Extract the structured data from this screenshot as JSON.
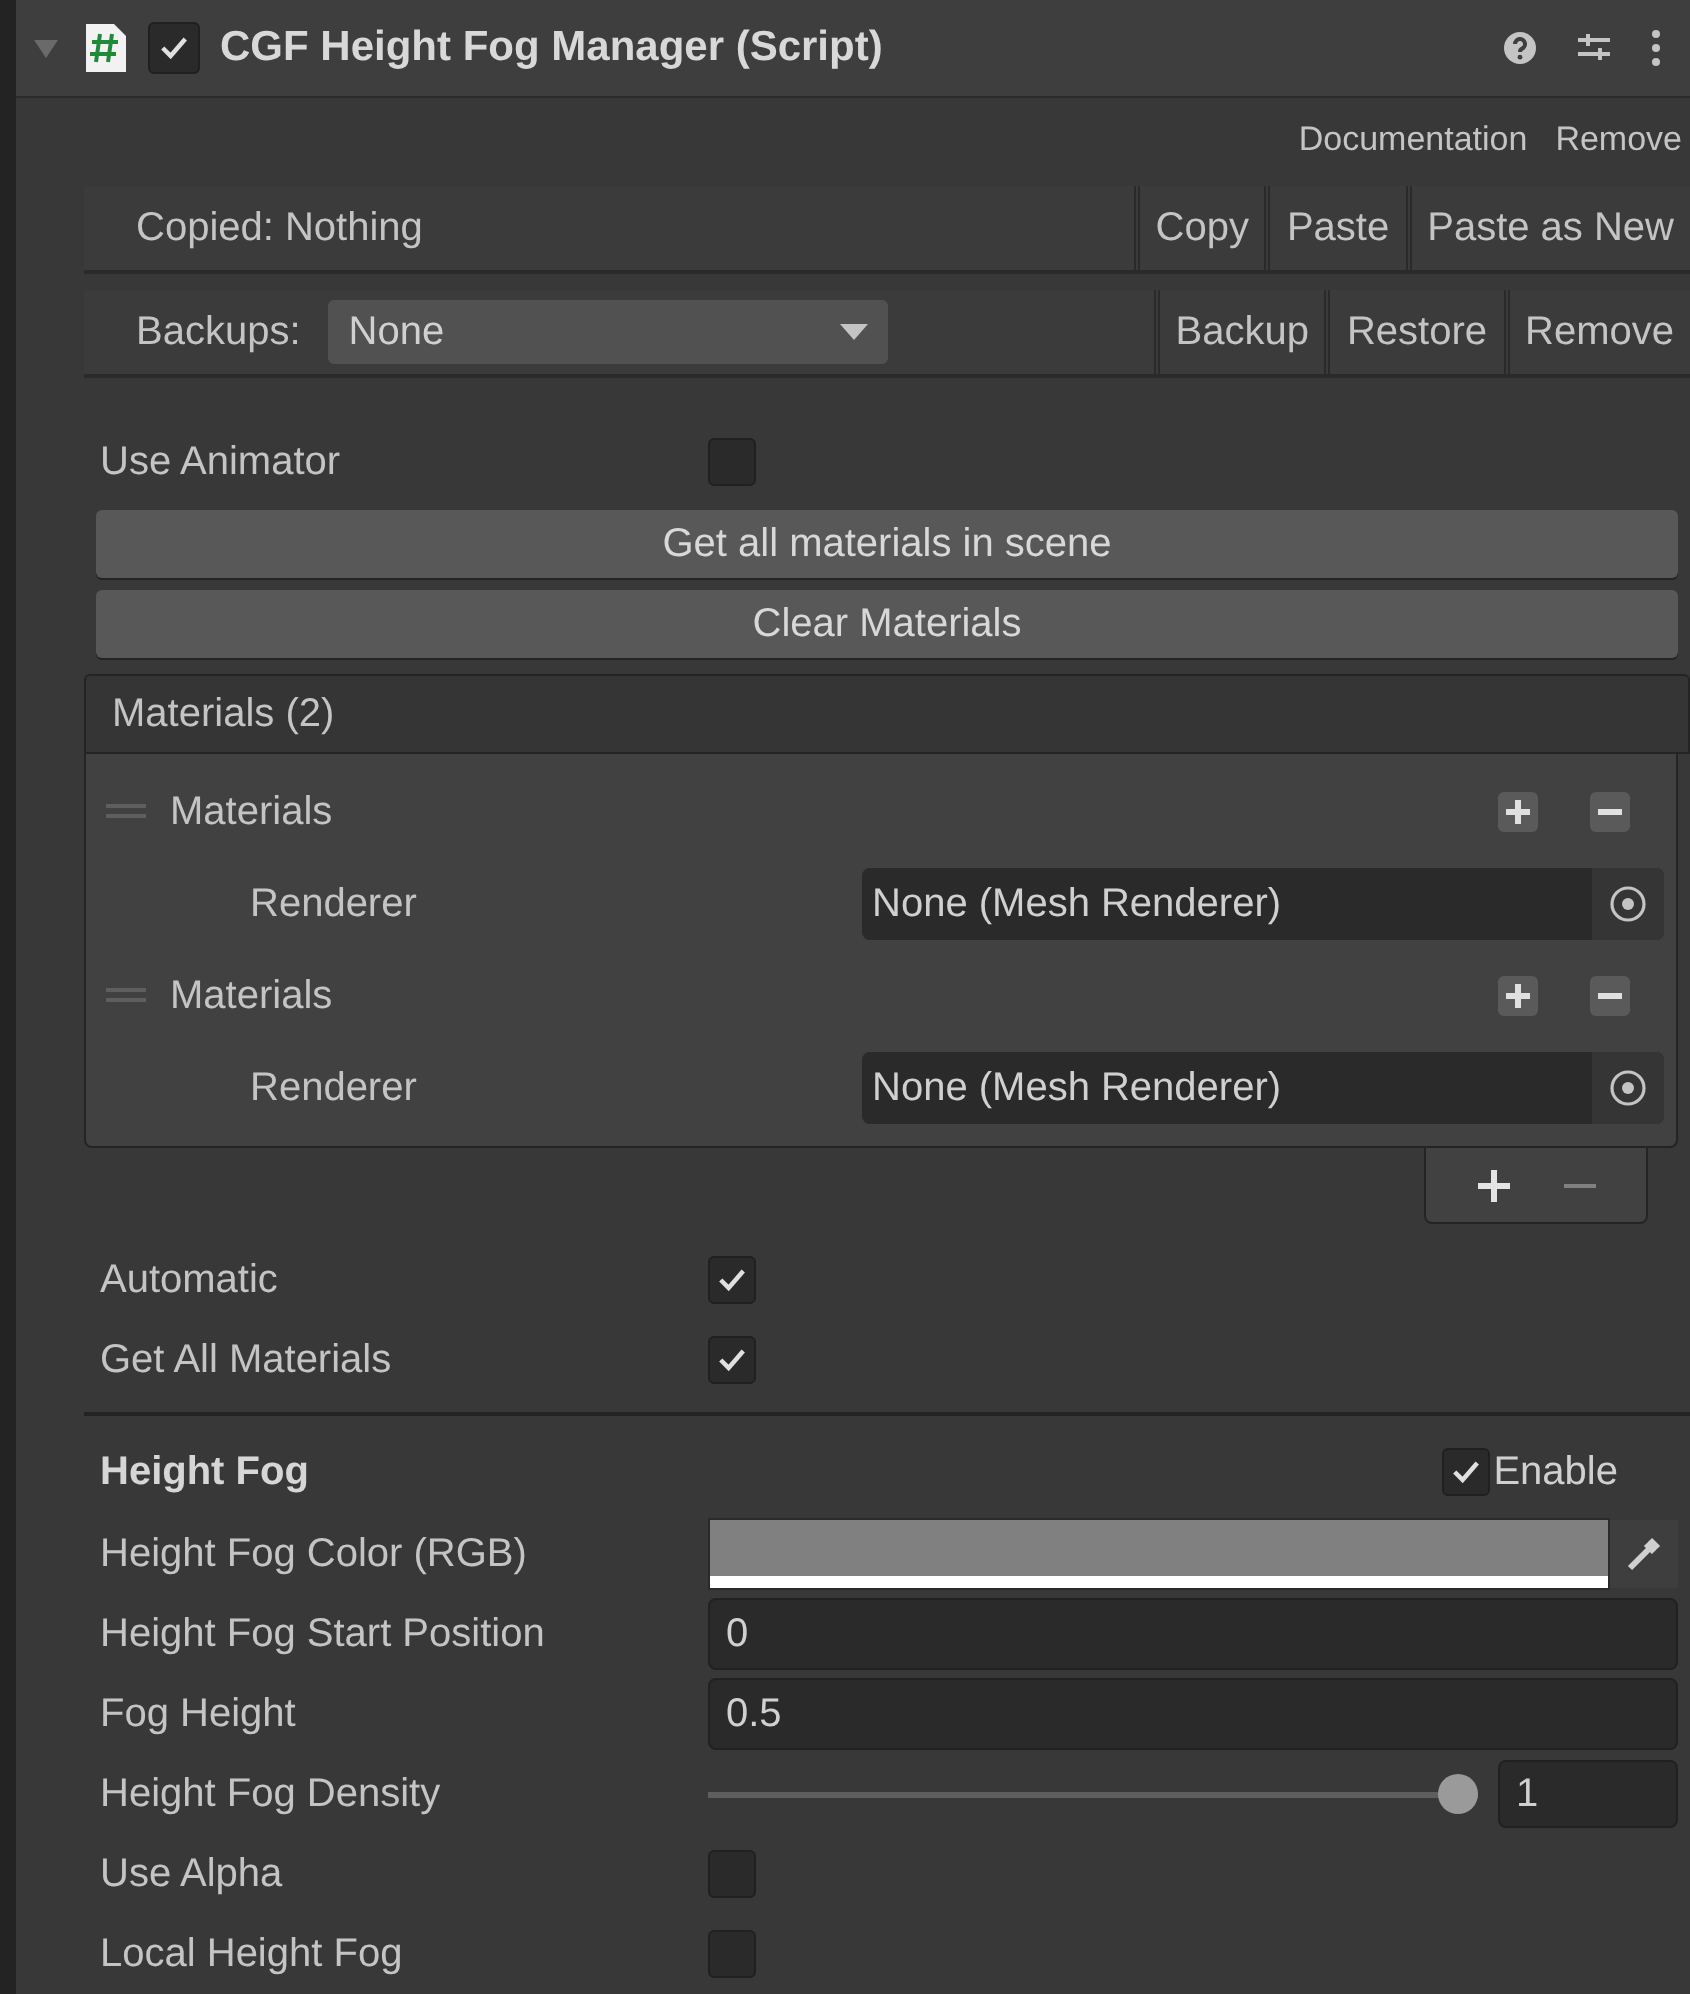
{
  "header": {
    "expanded": true,
    "enabled": true,
    "title": "CGF Height Fog Manager (Script)"
  },
  "links": [
    "Documentation",
    "Remove"
  ],
  "copy_row": {
    "label": "Copied: Nothing",
    "buttons": [
      "Copy",
      "Paste",
      "Paste as New"
    ]
  },
  "backup_row": {
    "label": "Backups:",
    "value": "None",
    "buttons": [
      "Backup",
      "Restore",
      "Remove"
    ]
  },
  "use_animator": {
    "label": "Use Animator",
    "checked": false
  },
  "actions": [
    "Get all materials in scene",
    "Clear Materials"
  ],
  "materials": {
    "title": "Materials (2)",
    "items": [
      {
        "label": "Materials",
        "field_label": "Renderer",
        "value": "None (Mesh Renderer)"
      },
      {
        "label": "Materials",
        "field_label": "Renderer",
        "value": "None (Mesh Renderer)"
      }
    ]
  },
  "options": [
    {
      "label": "Automatic",
      "checked": true
    },
    {
      "label": "Get All Materials",
      "checked": true
    }
  ],
  "section": {
    "title": "Height Fog",
    "toggle_label": "Enable",
    "enabled": true
  },
  "properties": [
    {
      "kind": "color",
      "label": "Height Fog Color (RGB)",
      "color": "#808080"
    },
    {
      "kind": "number",
      "label": "Height Fog Start Position",
      "value": "0"
    },
    {
      "kind": "number",
      "label": "Fog Height",
      "value": "0.5"
    },
    {
      "kind": "slider",
      "label": "Height Fog Density",
      "level": 1,
      "value": "1"
    },
    {
      "kind": "checkbox",
      "label": "Use Alpha",
      "checked": false
    },
    {
      "kind": "checkbox",
      "label": "Local Height Fog",
      "checked": false
    }
  ]
}
